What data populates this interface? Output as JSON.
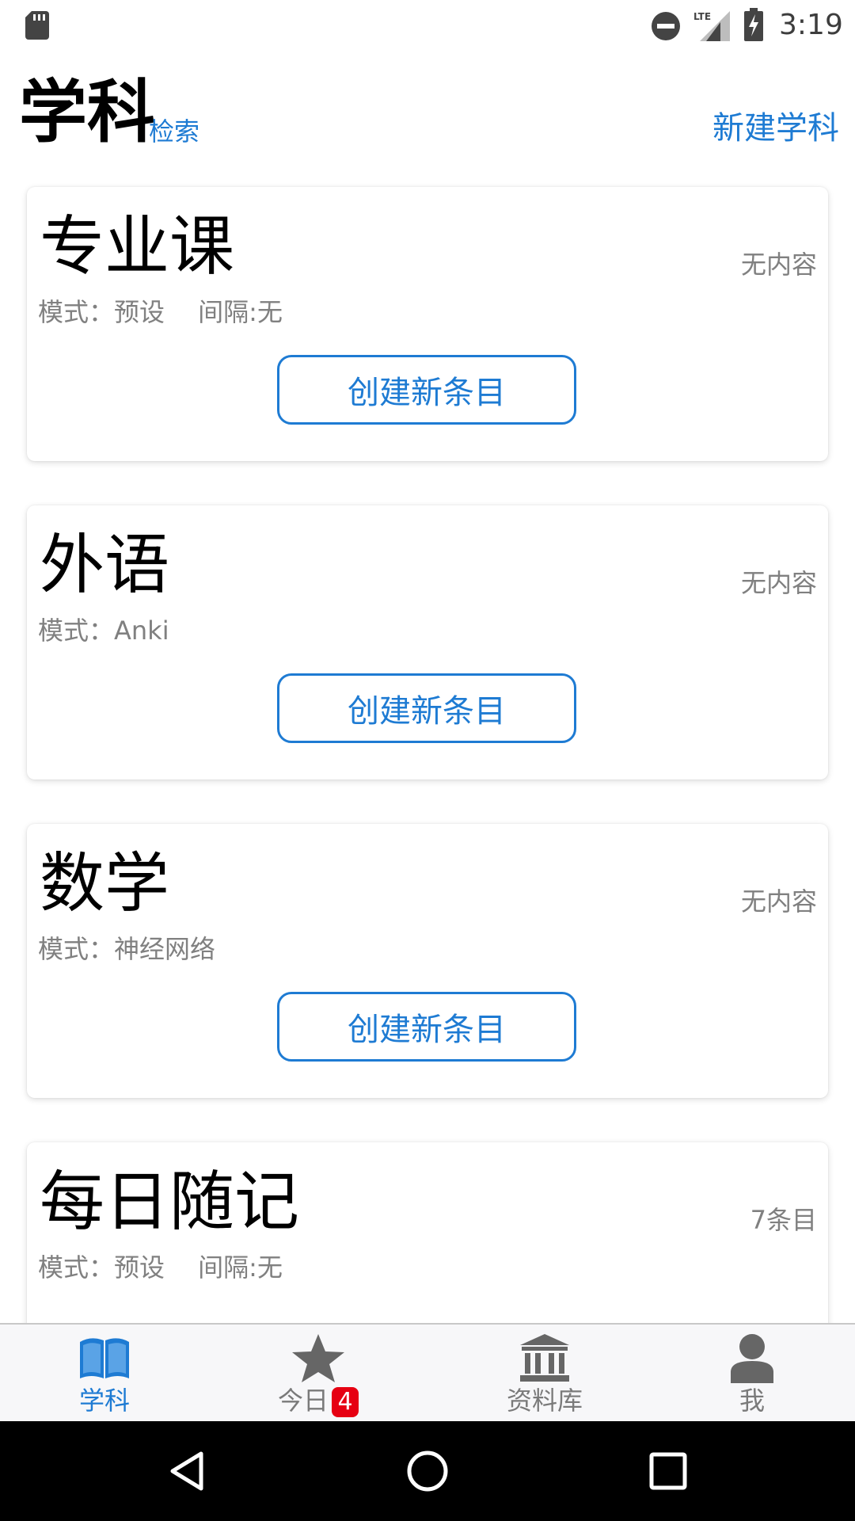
{
  "status_bar": {
    "time": "3:19",
    "network_label": "LTE",
    "icons": [
      "sd-card-icon",
      "do-not-disturb-icon",
      "lte-signal-icon",
      "battery-charging-icon"
    ]
  },
  "header": {
    "title": "学科",
    "search_label": "检索",
    "new_subject_label": "新建学科"
  },
  "cards": [
    {
      "title": "专业课",
      "count": "无内容",
      "mode": "模式：预设　 间隔:无",
      "button": "创建新条目"
    },
    {
      "title": "外语",
      "count": "无内容",
      "mode": "模式：Anki",
      "button": "创建新条目"
    },
    {
      "title": "数学",
      "count": "无内容",
      "mode": "模式：神经网络",
      "button": "创建新条目"
    },
    {
      "title": "每日随记",
      "count": "7条目",
      "mode": "模式：预设　 间隔:无"
    }
  ],
  "bottom_nav": {
    "items": [
      {
        "label": "学科",
        "icon": "book-icon",
        "active": true
      },
      {
        "label": "今日",
        "icon": "star-icon",
        "badge": "4"
      },
      {
        "label": "资料库",
        "icon": "library-icon"
      },
      {
        "label": "我",
        "icon": "person-icon"
      }
    ]
  },
  "colors": {
    "accent": "#1e7bd3",
    "badge": "#e60012",
    "muted_text": "#808080",
    "inactive_icon": "#666666"
  },
  "system_nav": {
    "icons": [
      "back-icon",
      "home-icon",
      "recents-icon"
    ]
  }
}
